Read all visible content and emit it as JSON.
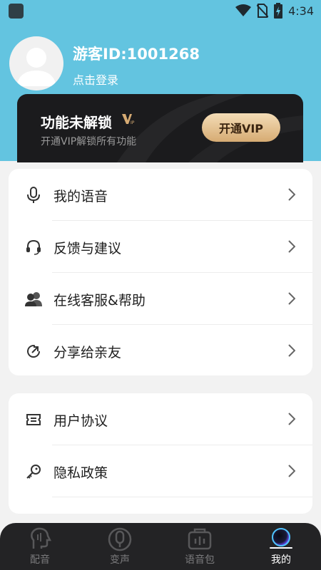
{
  "status_bar": {
    "time": "4:34"
  },
  "header": {
    "user_id": "游客ID:1001268",
    "login_label": "点击登录"
  },
  "vip": {
    "title": "功能未解锁",
    "subtitle": "开通VIP解锁所有功能",
    "button_label": "开通VIP",
    "accent": "#d6ab73"
  },
  "menu_group_1": [
    {
      "label": "我的语音",
      "icon": "microphone-icon"
    },
    {
      "label": "反馈与建议",
      "icon": "headset-icon"
    },
    {
      "label": "在线客服&帮助",
      "icon": "users-icon"
    },
    {
      "label": "分享给亲友",
      "icon": "share-icon"
    }
  ],
  "menu_group_2": [
    {
      "label": "用户协议",
      "icon": "ticket-icon"
    },
    {
      "label": "隐私政策",
      "icon": "key-icon"
    }
  ],
  "tabs": [
    {
      "label": "配音",
      "icon": "dub-icon",
      "active": false
    },
    {
      "label": "变声",
      "icon": "voice-change-icon",
      "active": false
    },
    {
      "label": "语音包",
      "icon": "voice-pack-icon",
      "active": false
    },
    {
      "label": "我的",
      "icon": "profile-orb-icon",
      "active": true
    }
  ],
  "colors": {
    "header_bg": "#63c4e0",
    "tabbar_bg": "#232325"
  }
}
